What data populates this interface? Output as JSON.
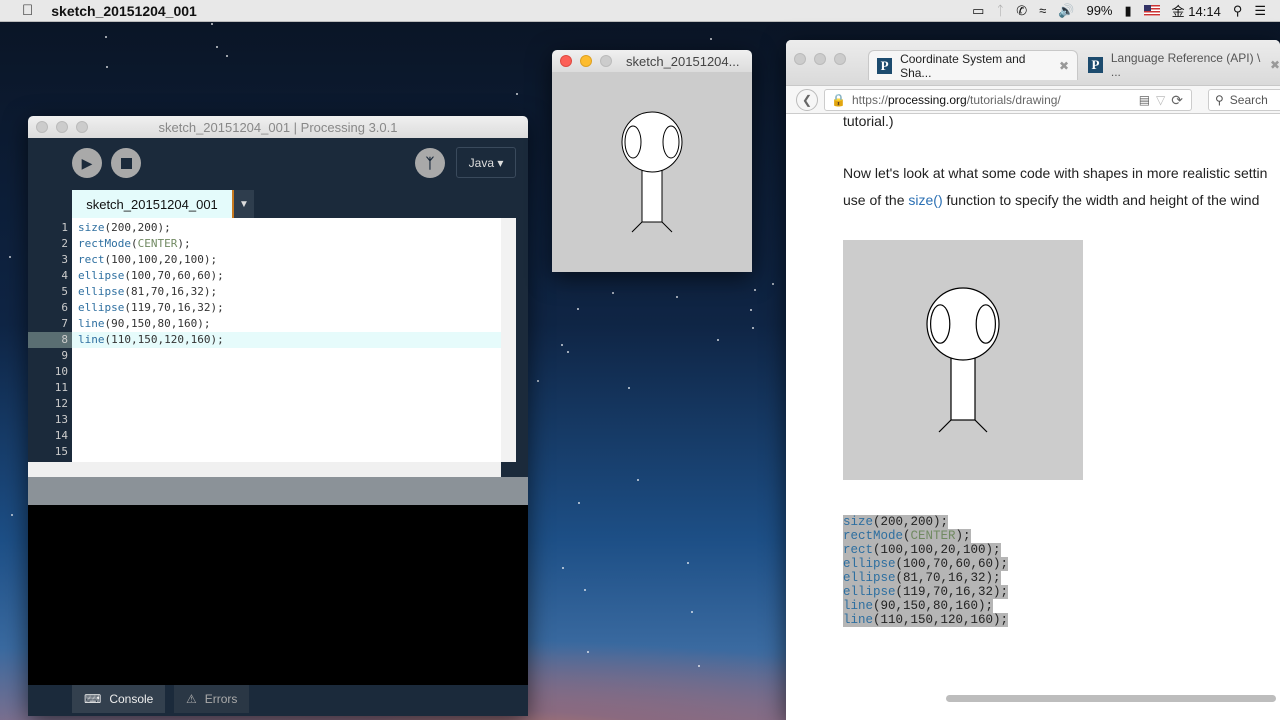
{
  "menubar": {
    "app_name": "sketch_20151204_001",
    "battery": "99%",
    "clock": "金 14:14"
  },
  "processing": {
    "title": "sketch_20151204_001 | Processing 3.0.1",
    "mode": "Java ▾",
    "tab": "sketch_20151204_001",
    "current_line": 8,
    "code": [
      [
        [
          "kw",
          "size"
        ],
        [
          "",
          "(200,200);"
        ]
      ],
      [
        [
          "kw",
          "rectMode"
        ],
        [
          "",
          "("
        ],
        [
          "cn",
          "CENTER"
        ],
        [
          "",
          ");"
        ]
      ],
      [
        [
          "kw",
          "rect"
        ],
        [
          "",
          "(100,100,20,100);"
        ]
      ],
      [
        [
          "kw",
          "ellipse"
        ],
        [
          "",
          "(100,70,60,60);"
        ]
      ],
      [
        [
          "kw",
          "ellipse"
        ],
        [
          "",
          "(81,70,16,32);"
        ]
      ],
      [
        [
          "kw",
          "ellipse"
        ],
        [
          "",
          "(119,70,16,32);"
        ]
      ],
      [
        [
          "kw",
          "line"
        ],
        [
          "",
          "(90,150,80,160);"
        ]
      ],
      [
        [
          "kw",
          "line"
        ],
        [
          "",
          "(110,150,120,160);"
        ]
      ]
    ],
    "line_count": 15,
    "console_tab": "Console",
    "errors_tab": "Errors"
  },
  "sketch_window": {
    "title": "sketch_20151204..."
  },
  "browser": {
    "tabs": [
      {
        "label": "Coordinate System and Sha..."
      },
      {
        "label": "Language Reference (API) \\ ..."
      }
    ],
    "url_prefix": "https://",
    "url_host": "processing.org",
    "url_path": "/tutorials/drawing/",
    "search_placeholder": "Search",
    "text_top": "tutorial.)",
    "para1": "Now let's look at what some code with shapes in more realistic settin",
    "para2_a": "use of the ",
    "para2_link": "size()",
    "para2_b": " function to specify the width and height of the wind"
  }
}
